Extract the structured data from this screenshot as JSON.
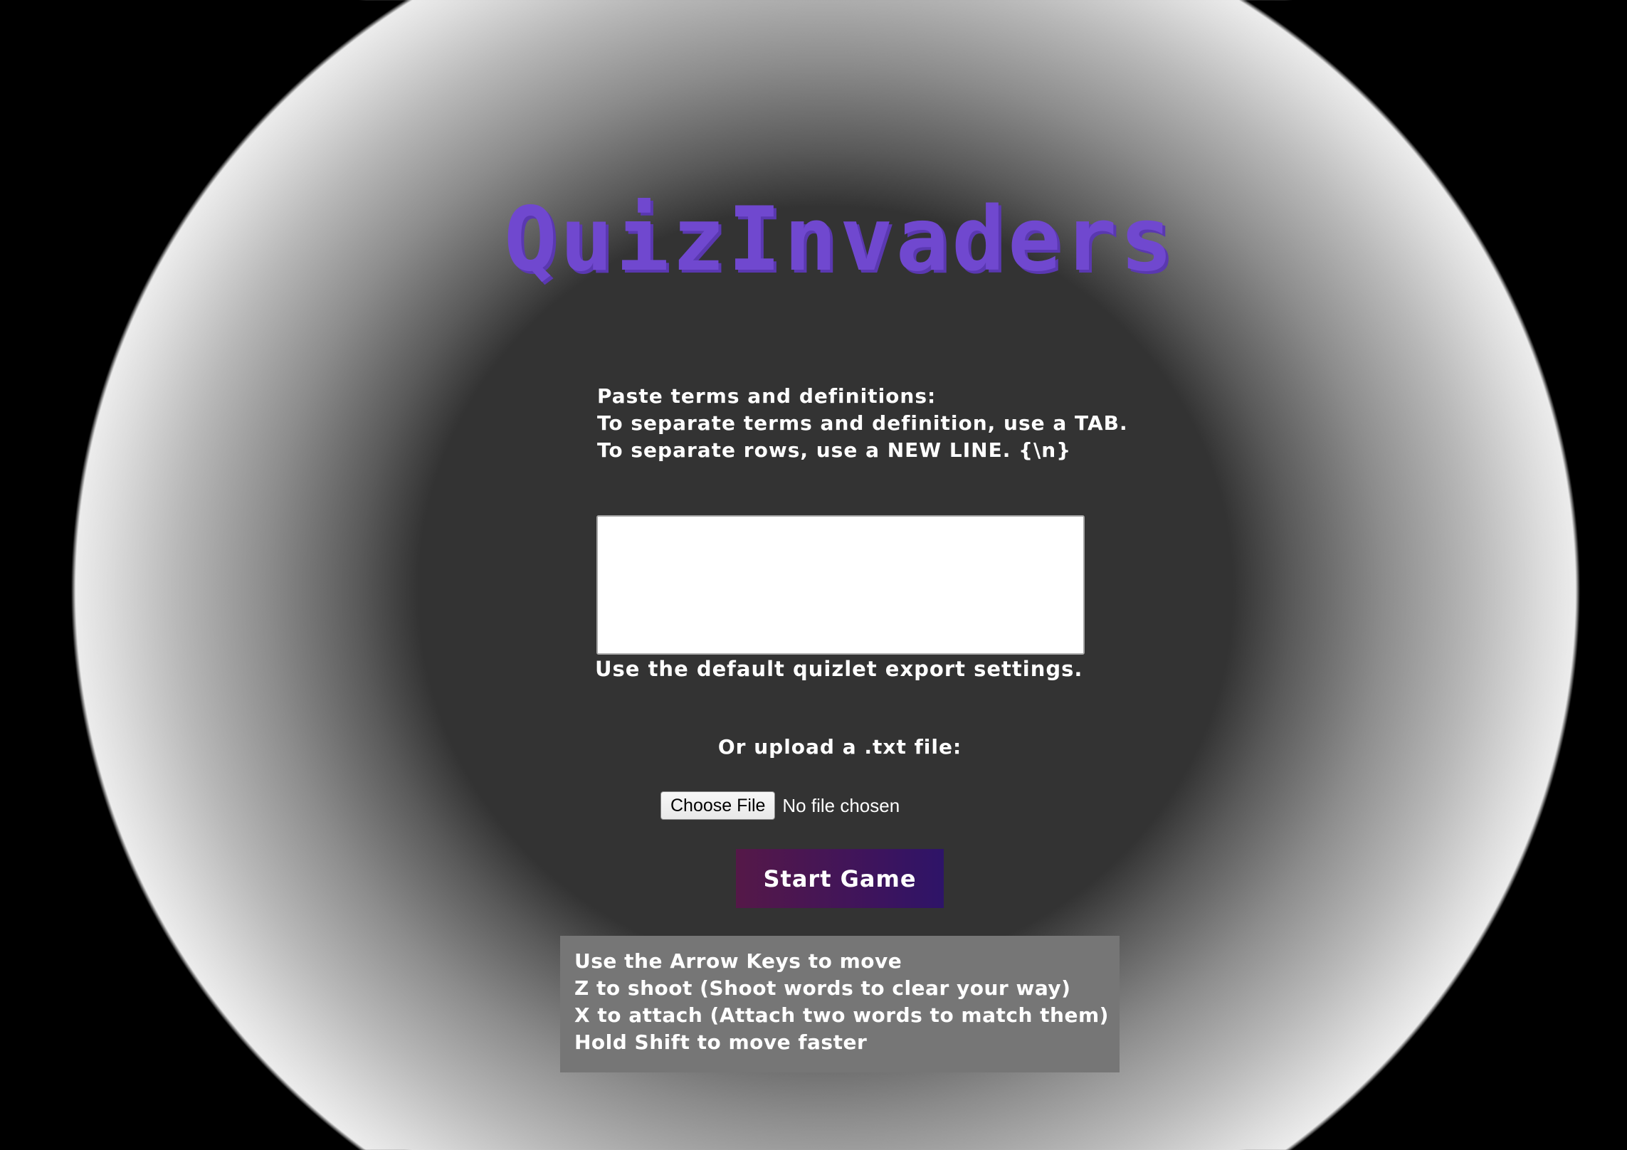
{
  "title": "QuizInvaders",
  "instructions": {
    "line1": "Paste terms and definitions:",
    "line2": "To separate terms and definition, use a TAB.",
    "line3": "To separate rows, use a NEW LINE. {\\n}"
  },
  "terms_input": {
    "value": ""
  },
  "hint": "Use the default quizlet export settings.",
  "upload": {
    "label": "Or upload a .txt file:",
    "button_label": "Choose File",
    "status": "No file chosen"
  },
  "start_button_label": "Start Game",
  "controls": [
    "Use the Arrow Keys to move",
    "Z to shoot (Shoot words to clear your way)",
    "X to attach (Attach two words to match them)",
    "Hold Shift to move faster"
  ],
  "colors": {
    "title": "#7048cf",
    "background": "#333333",
    "start_button_start": "#551848",
    "start_button_end": "#2e1468",
    "controls_panel": "#767676"
  }
}
